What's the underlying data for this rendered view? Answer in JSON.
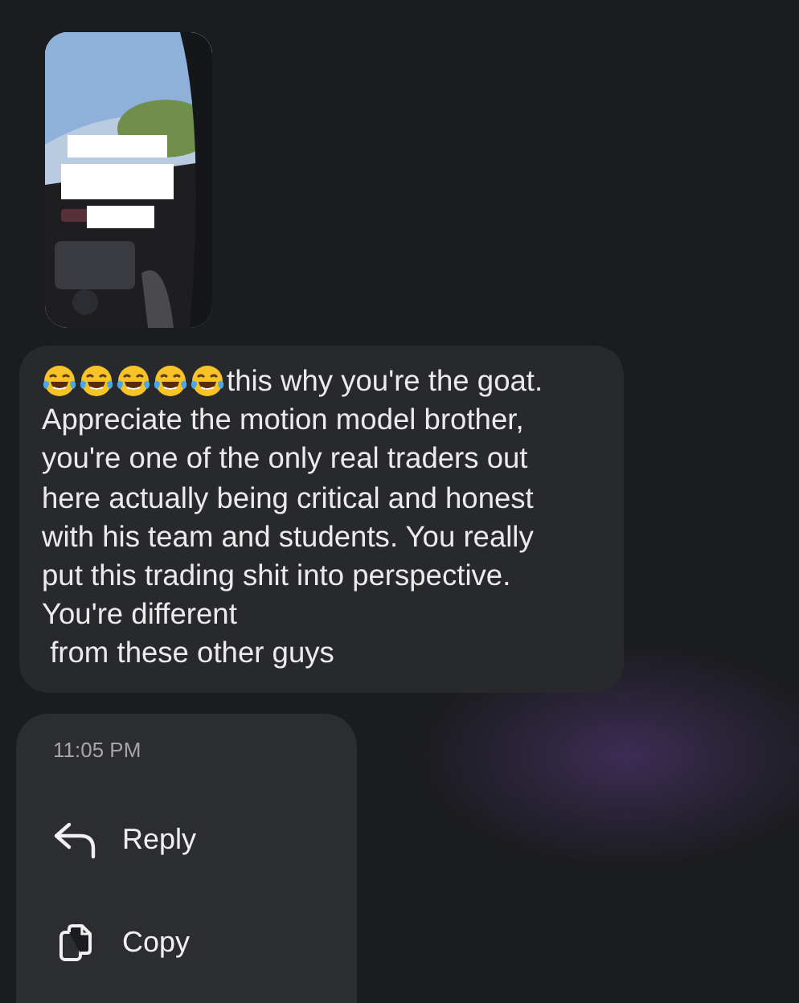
{
  "message": {
    "emojis": [
      {
        "kind": "laughing"
      },
      {
        "kind": "laughing"
      },
      {
        "kind": "laughing"
      },
      {
        "kind": "laughing"
      },
      {
        "kind": "laughing"
      }
    ],
    "first_line": "this why you're the goat.",
    "text": "Appreciate the motion model brother,\nyou're one of the only real traders out\nhere actually being critical and honest\nwith his team and students. You really\nput this trading shit into perspective.\nYou're different\n from these other guys"
  },
  "context_menu": {
    "time": "11:05 PM",
    "actions": [
      {
        "kind": "reply",
        "label": "Reply"
      },
      {
        "kind": "copy",
        "label": "Copy"
      }
    ]
  }
}
